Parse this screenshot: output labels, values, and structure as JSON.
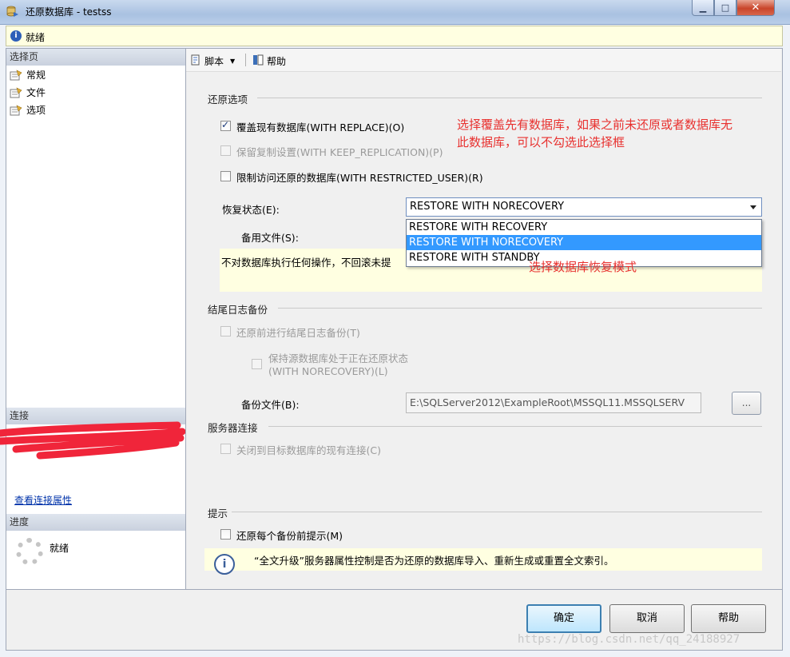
{
  "window": {
    "title": "还原数据库 - testss",
    "min_label": "▁",
    "max_label": "□",
    "close_label": "✕"
  },
  "status": {
    "icon_glyph": "i",
    "text": "就绪"
  },
  "left": {
    "select_page_header": "选择页",
    "nav": [
      {
        "label": "常规"
      },
      {
        "label": "文件"
      },
      {
        "label": "选项"
      }
    ],
    "connection_header": "连接",
    "view_connection_link": "查看连接属性",
    "progress_header": "进度",
    "progress_status": "就绪"
  },
  "toolbar": {
    "script_label": "脚本",
    "help_label": "帮助"
  },
  "restore_options": {
    "section_title": "还原选项",
    "replace_label": "覆盖现有数据库(WITH REPLACE)(O)",
    "keep_replication_label": "保留复制设置(WITH KEEP_REPLICATION)(P)",
    "restricted_user_label": "限制访问还原的数据库(WITH RESTRICTED_USER)(R)",
    "recovery_state_label": "恢复状态(E):",
    "recovery_state_value": "RESTORE WITH NORECOVERY",
    "recovery_options": [
      "RESTORE WITH RECOVERY",
      "RESTORE WITH NORECOVERY",
      "RESTORE WITH STANDBY"
    ],
    "standby_file_label": "备用文件(S):",
    "description": "不对数据库执行任何操作，不回滚未提"
  },
  "annotations": {
    "replace_note_line1": "选择覆盖先有数据库，如果之前未还原或者数据库无",
    "replace_note_line2": "此数据库，可以不勾选此选择框",
    "recovery_note": "选择数据库恢复模式"
  },
  "tail_log": {
    "section_title": "结尾日志备份",
    "take_tail_label": "还原前进行结尾日志备份(T)",
    "leave_source_line1": "保持源数据库处于正在还原状态",
    "leave_source_line2": "(WITH NORECOVERY)(L)",
    "backup_file_label": "备份文件(B):",
    "backup_file_value": "E:\\SQLServer2012\\ExampleRoot\\MSSQL11.MSSQLSERV",
    "browse_label": "..."
  },
  "server_connection": {
    "section_title": "服务器连接",
    "close_connections_label": "关闭到目标数据库的现有连接(C)"
  },
  "prompt": {
    "section_title": "提示",
    "prompt_each_label": "还原每个备份前提示(M)",
    "info_glyph": "i",
    "info_text": "“全文升级”服务器属性控制是否为还原的数据库导入、重新生成或重置全文索引。"
  },
  "buttons": {
    "ok": "确定",
    "cancel": "取消",
    "help": "帮助"
  },
  "watermark": "https://blog.csdn.net/qq_24188927",
  "colors": {
    "annotation_red": "#e8312f",
    "selection_blue": "#3399ff",
    "info_yellow": "#ffffe1",
    "link_blue": "#0033aa"
  }
}
